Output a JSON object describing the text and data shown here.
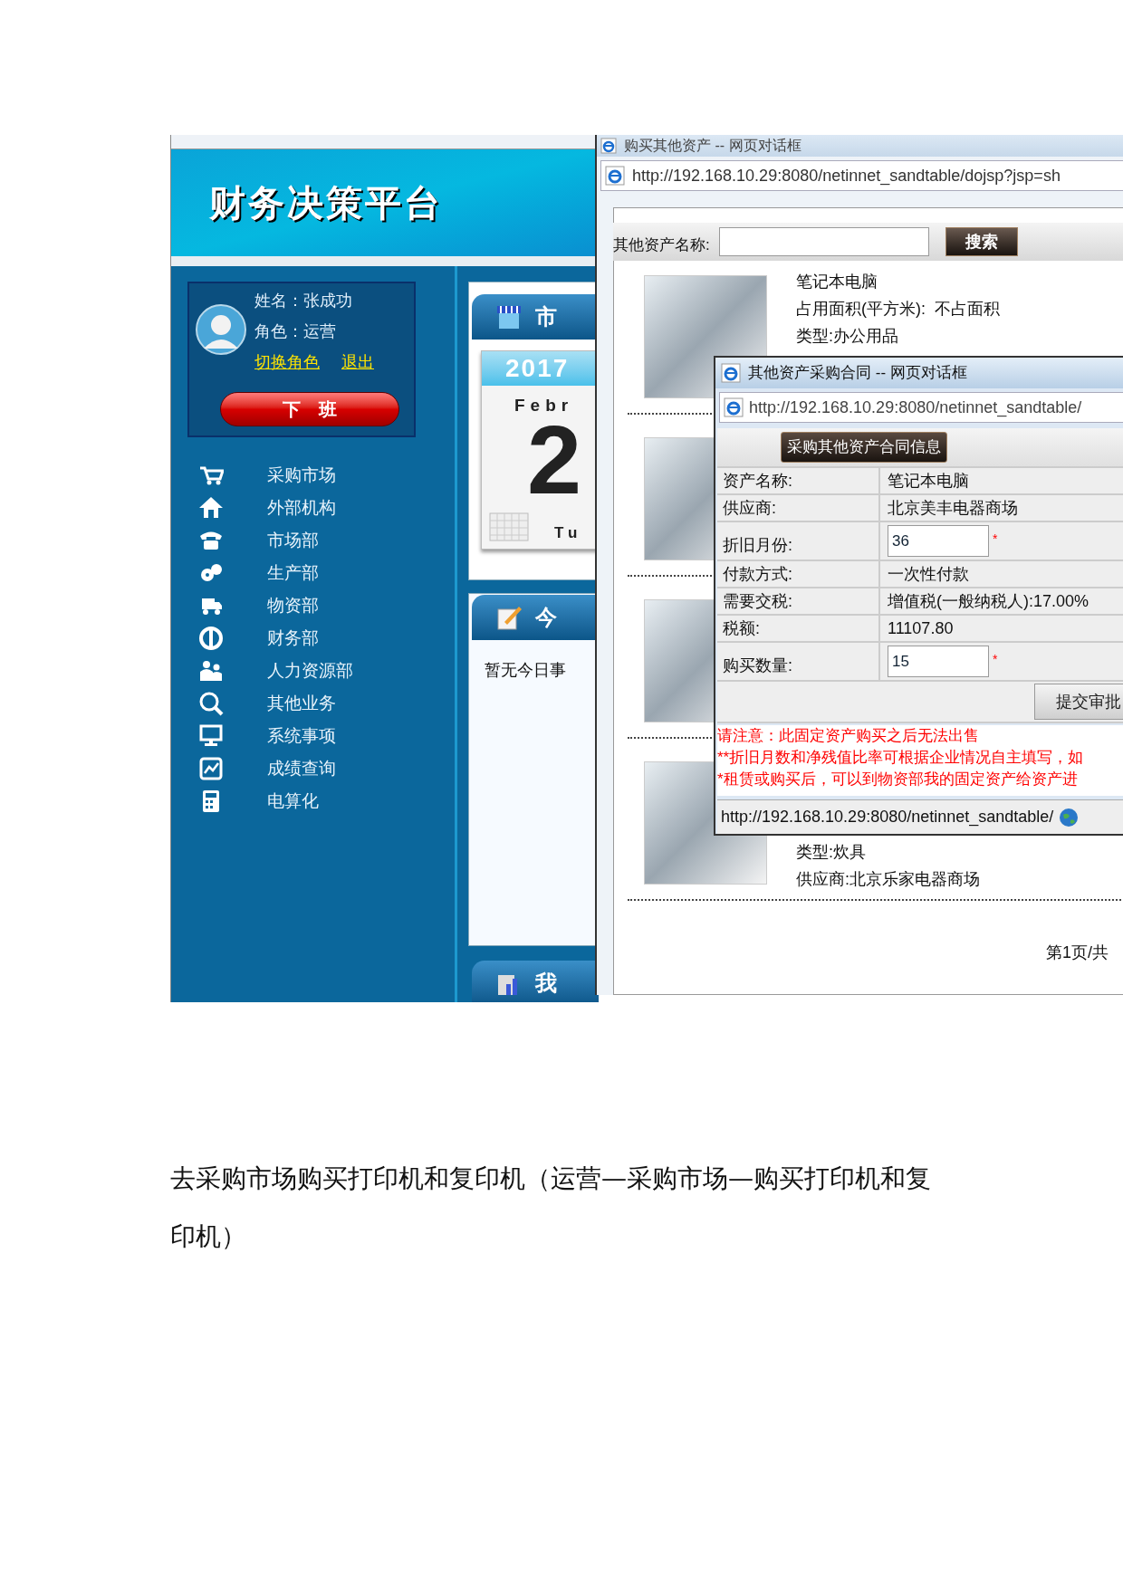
{
  "app": {
    "title": "财务决策平台",
    "user": {
      "name": "姓名：张成功",
      "role": "角色：运营",
      "links": [
        "切换角色",
        "退出"
      ],
      "off_duty_button": "下　班"
    },
    "nav": [
      {
        "label": "采购市场"
      },
      {
        "label": "外部机构"
      },
      {
        "label": "市场部"
      },
      {
        "label": "生产部"
      },
      {
        "label": "物资部"
      },
      {
        "label": "财务部"
      },
      {
        "label": "人力资源部"
      },
      {
        "label": "其他业务"
      },
      {
        "label": "系统事项"
      },
      {
        "label": "成绩查询"
      },
      {
        "label": "电算化"
      }
    ],
    "panels": [
      {
        "title": "市"
      },
      {
        "title": "今"
      },
      {
        "title": "我"
      }
    ],
    "calendar": {
      "year": "2017",
      "month": "Febr",
      "day": "2",
      "weekday": "Tu"
    },
    "today_text": "暂无今日事"
  },
  "asset_dialog": {
    "title": "购买其他资产 -- 网页对话框",
    "url": "http://192.168.10.29:8080/netinnet_sandtable/dojsp?jsp=sh",
    "search": {
      "label": "其他资产名称:",
      "button": "搜索"
    },
    "products": [
      {
        "lines": [
          "笔记本电脑",
          "占用面积(平方米):  不占面积",
          "类型:办公用品"
        ]
      },
      {
        "lines": [
          "类型:炊具",
          "供应商:北京乐家电器商场"
        ]
      }
    ],
    "pager": "第1页/共"
  },
  "contract_dialog": {
    "title": "其他资产采购合同 -- 网页对话框",
    "url": "http://192.168.10.29:8080/netinnet_sandtable/",
    "section_button": "采购其他资产合同信息",
    "rows": [
      {
        "kind": "text",
        "label": "资产名称:",
        "value": "笔记本电脑"
      },
      {
        "kind": "text",
        "label": "供应商:",
        "value": "北京美丰电器商场"
      },
      {
        "kind": "input",
        "label": "折旧月份:",
        "value": "36",
        "required_mark": "*"
      },
      {
        "kind": "text",
        "label": "付款方式:",
        "value": "一次性付款"
      },
      {
        "kind": "text",
        "label": "需要交税:",
        "value": "增值税(一般纳税人):17.00%"
      },
      {
        "kind": "text",
        "label": "税额:",
        "value": "11107.80"
      },
      {
        "kind": "input",
        "label": "购买数量:",
        "value": "15",
        "required_mark": "*"
      }
    ],
    "submit_button": "提交审批",
    "notes": [
      "请注意：此固定资产购买之后无法出售",
      "**折旧月数和净残值比率可根据企业情况自主填写，如",
      "*租赁或购买后，可以到物资部我的固定资产给资产进"
    ],
    "status_url": "http://192.168.10.29:8080/netinnet_sandtable/"
  },
  "caption": "去采购市场购买打印机和复印机（运营—采购市场—购买打印机和复印机）"
}
